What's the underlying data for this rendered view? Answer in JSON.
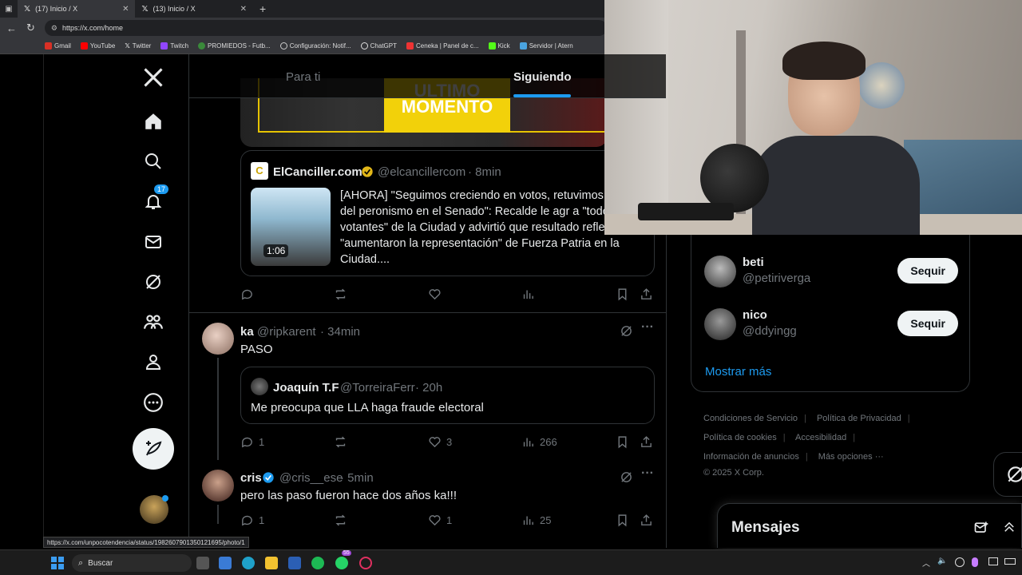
{
  "browser": {
    "tabs": [
      {
        "label": "(17) Inicio / X",
        "active": true
      },
      {
        "label": "(13) Inicio / X",
        "active": false
      }
    ],
    "url": "https://x.com/home",
    "bookmarks": [
      "Gmail",
      "YouTube",
      "Twitter",
      "Twitch",
      "PROMIEDOS - Futb...",
      "Configuración: Notif...",
      "ChatGPT",
      "Ceneka | Panel de c...",
      "Kick",
      "Servidor | Atern"
    ],
    "status_url": "https://x.com/unpocotendencia/status/1982607901350121695/photo/1"
  },
  "sidebar": {
    "notifications_badge": "17"
  },
  "feed": {
    "tab_for_you": "Para ti",
    "tab_following": "Siguiendo",
    "banner_text": "ULTIMO MOMENTO",
    "quoted_post": {
      "name": "ElCanciller.com",
      "handle": "@elcancillercom",
      "time": "· 8min",
      "video_duration": "1:06",
      "text": "[AHORA] \"Seguimos creciendo en votos, retuvimos banca del peronismo en el Senado\": Recalde le agr a \"todos los votantes\" de la Ciudad y advirtió que resultado refleja que \"aumentaron la representación\" de Fuerza Patria en la Ciudad...."
    },
    "posts": [
      {
        "name": "ka",
        "handle": "@ripkarent",
        "time": "· 34min",
        "text": "PASO",
        "quote": {
          "name": "Joaquín T.F",
          "handle": "@TorreiraFerr",
          "time": "· 20h",
          "text": "Me preocupa que LLA haga fraude electoral"
        },
        "replies": "1",
        "likes": "3",
        "views": "266"
      },
      {
        "name": "cris",
        "handle": "@cris__ese",
        "time": "· 5min",
        "text": "pero las paso fueron hace dos años ka!!!",
        "replies": "1",
        "likes": "1",
        "views": "25"
      }
    ]
  },
  "right": {
    "follow_suggestions": [
      {
        "name": "beti",
        "handle": "@petiriverga",
        "button": "Sequir"
      },
      {
        "name": "nico",
        "handle": "@ddyingg",
        "button": "Sequir"
      }
    ],
    "show_more": "Mostrar más",
    "footer": [
      "Condiciones de Servicio",
      "Política de Privacidad",
      "Política de cookies",
      "Accesibilidad",
      "Información de anuncios",
      "Más opciones ···",
      "© 2025 X Corp."
    ],
    "messages_title": "Mensajes"
  },
  "taskbar": {
    "search_placeholder": "Buscar",
    "whatsapp_badge": "55"
  },
  "colors": {
    "accent": "#1d9bf0",
    "background": "#000000",
    "border": "#2f3336",
    "muted": "#71767b"
  }
}
